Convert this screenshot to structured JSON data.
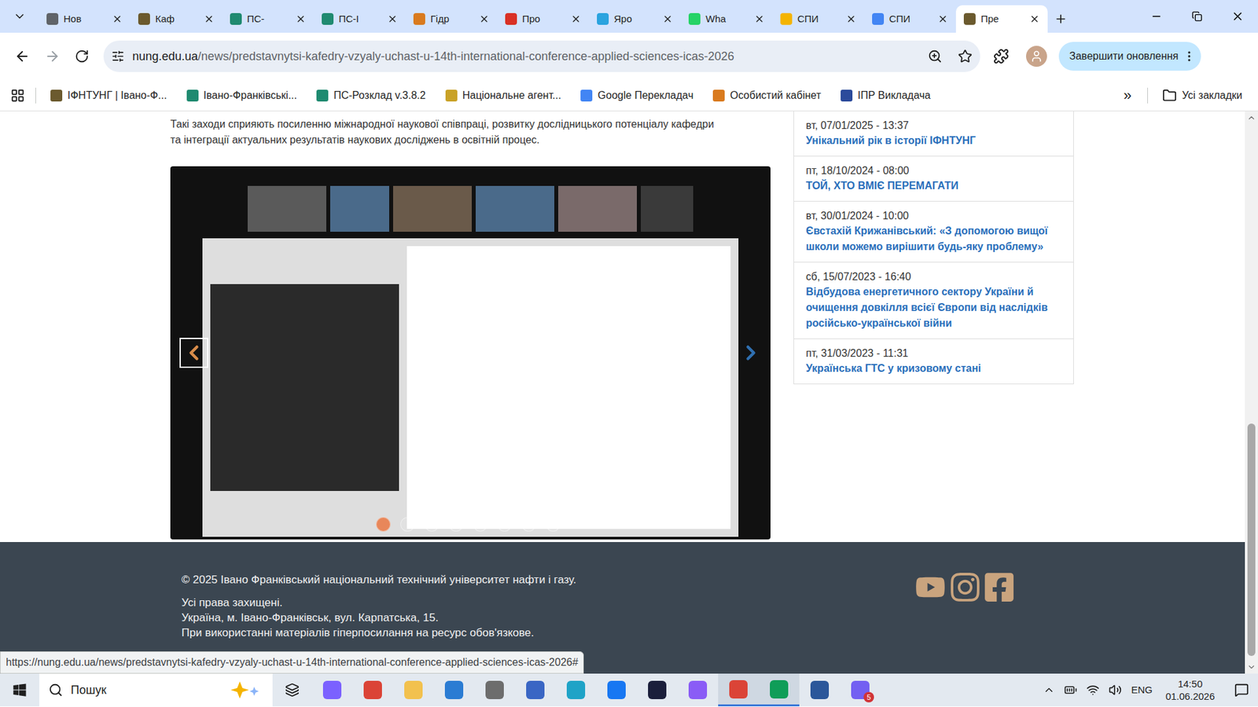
{
  "browser": {
    "tabs": [
      {
        "label": "Нов",
        "selected": false,
        "color": "#5f6368"
      },
      {
        "label": "Каф",
        "selected": false,
        "color": "#6b5a2e"
      },
      {
        "label": "ПС-",
        "selected": false,
        "color": "#1f8a70"
      },
      {
        "label": "ПС-І",
        "selected": false,
        "color": "#1f8a70"
      },
      {
        "label": "Гідр",
        "selected": false,
        "color": "#d97a1e"
      },
      {
        "label": "Про",
        "selected": false,
        "color": "#d93025"
      },
      {
        "label": "Яро",
        "selected": false,
        "color": "#2aa3df"
      },
      {
        "label": "Wha",
        "selected": false,
        "color": "#25d366"
      },
      {
        "label": "СПИ",
        "selected": false,
        "color": "#f4b400"
      },
      {
        "label": "СПИ",
        "selected": false,
        "color": "#4285f4"
      },
      {
        "label": "Пре",
        "selected": true,
        "color": "#6b5a2e"
      }
    ],
    "url_host": "nung.edu.ua",
    "url_path": "/news/predstavnytsi-kafedry-vzyaly-uchast-u-14th-international-conference-applied-sciences-icas-2026",
    "update_button": "Завершити оновлення",
    "bookmarks": [
      {
        "label": "ІФНТУНГ | Івано-Ф...",
        "color": "#6b5a2e"
      },
      {
        "label": "Івано-Франківськi...",
        "color": "#1f8a70"
      },
      {
        "label": "ПС-Розклад v.3.8.2",
        "color": "#1f8a70"
      },
      {
        "label": "Національне агент...",
        "color": "#c9a227"
      },
      {
        "label": "Google Перекладач",
        "color": "#4285f4"
      },
      {
        "label": "Особистий кабінет",
        "color": "#d97a1e"
      },
      {
        "label": "ІПР Викладача",
        "color": "#2b4a9b"
      }
    ],
    "more_bookmarks": "»",
    "all_bookmarks": "Усі закладки"
  },
  "article": {
    "paragraph_lines": [
      "Такі заходи сприяють посиленню міжнародної наукової співпраці, розвитку дослідницького потенціалу кафедри",
      "та інтеграції актуальних результатів наукових досліджень в освітній процес."
    ],
    "slider": {
      "prev_focused": true,
      "slides": [
        {
          "selected": true
        },
        {
          "selected": false
        },
        {
          "selected": false
        },
        {
          "selected": false
        },
        {
          "selected": false
        },
        {
          "selected": false
        },
        {
          "selected": false
        },
        {
          "selected": false
        }
      ]
    }
  },
  "sidebar": {
    "news": [
      {
        "date": "вт, 07/01/2025 - 13:37",
        "title": "Унікальний рік в історії ІФНТУНГ"
      },
      {
        "date": "пт, 18/10/2024 - 08:00",
        "title": "ТОЙ, ХТО ВМІЄ ПЕРЕМАГАТИ"
      },
      {
        "date": "вт, 30/01/2024 - 10:00",
        "title": "Євстахій Крижанівський: «З допомогою вищої школи можемо вирішити будь-яку проблему»"
      },
      {
        "date": "сб, 15/07/2023 - 16:40",
        "title": "Відбудова енергетичного сектору України й очищення довкілля всієї Європи від наслідків російсько-української війни"
      },
      {
        "date": "пт, 31/03/2023 - 11:31",
        "title": "Українська ГТС у кризовому стані"
      }
    ]
  },
  "footer": {
    "copyright": "© 2025 Івано Франківський національний технічний університет нафти і газу.",
    "lines": [
      "Усі права захищені.",
      "Україна, м. Івано-Франківськ, вул. Карпатська, 15.",
      "При використанні матеріалів гіперпосилання на ресурс обов'язкове."
    ]
  },
  "status_link": "https://nung.edu.ua/news/predstavnytsi-kafedry-vzyaly-uchast-u-14th-international-conference-applied-sciences-icas-2026#",
  "taskbar": {
    "search_placeholder": "Пошук",
    "apps": [
      {
        "color": "#7b61ff",
        "active": false,
        "badge": ""
      },
      {
        "color": "#db4437",
        "active": false,
        "badge": ""
      },
      {
        "color": "#f2c14e",
        "active": false,
        "badge": ""
      },
      {
        "color": "#2b7cd3",
        "active": false,
        "badge": ""
      },
      {
        "color": "#6d6d6d",
        "active": false,
        "badge": ""
      },
      {
        "color": "#3a66c4",
        "active": false,
        "badge": ""
      },
      {
        "color": "#1fa3c7",
        "active": false,
        "badge": ""
      },
      {
        "color": "#1877f2",
        "active": false,
        "badge": ""
      },
      {
        "color": "#1b1f3b",
        "active": false,
        "badge": ""
      },
      {
        "color": "#8a5cf6",
        "active": false,
        "badge": ""
      },
      {
        "color": "#db4437",
        "active": true,
        "badge": ""
      },
      {
        "color": "#0f9d58",
        "active": true,
        "badge": ""
      },
      {
        "color": "#2b579a",
        "active": false,
        "badge": ""
      },
      {
        "color": "#7360f2",
        "active": false,
        "badge": "5"
      }
    ],
    "language": "ENG",
    "time": "14:50",
    "date": "01.06.2026"
  }
}
